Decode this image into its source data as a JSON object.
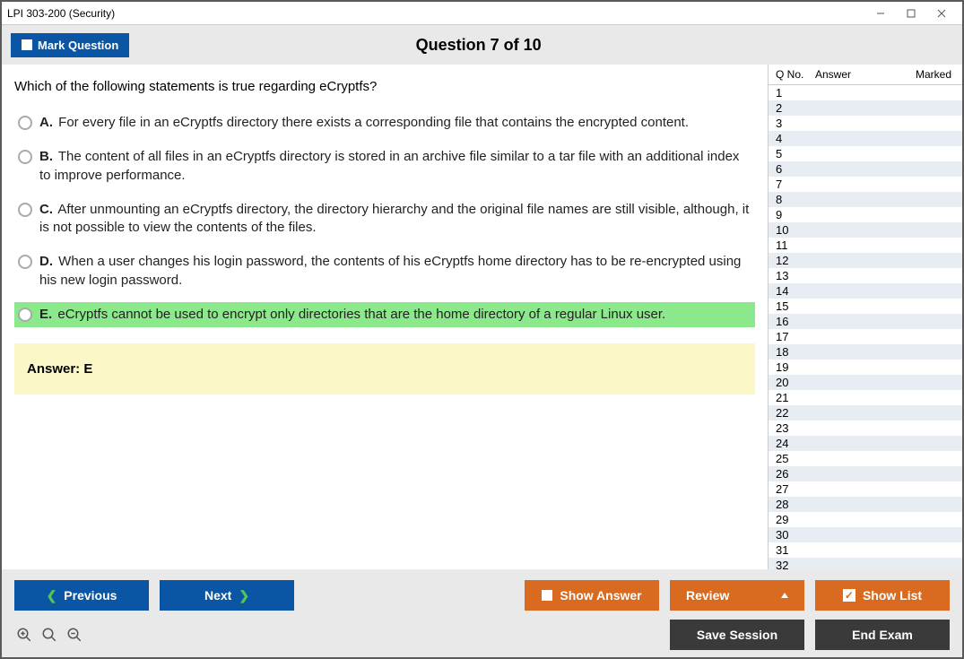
{
  "window": {
    "title": "LPI 303-200 (Security)"
  },
  "header": {
    "mark_label": "Mark Question",
    "question_title": "Question 7 of 10"
  },
  "question": {
    "prompt": "Which of the following statements is true regarding eCryptfs?",
    "options": [
      {
        "letter": "A.",
        "text": "For every file in an eCryptfs directory there exists a corresponding file that contains the encrypted content.",
        "highlight": false
      },
      {
        "letter": "B.",
        "text": "The content of all files in an eCryptfs directory is stored in an archive file similar to a tar file with an additional index to improve performance.",
        "highlight": false
      },
      {
        "letter": "C.",
        "text": "After unmounting an eCryptfs directory, the directory hierarchy and the original file names are still visible, although, it is not possible to view the contents of the files.",
        "highlight": false
      },
      {
        "letter": "D.",
        "text": "When a user changes his login password, the contents of his eCryptfs home directory has to be re-encrypted using his new login password.",
        "highlight": false
      },
      {
        "letter": "E.",
        "text": "eCryptfs cannot be used to encrypt only directories that are the home directory of a regular Linux user.",
        "highlight": true
      }
    ],
    "answer_label": "Answer: E"
  },
  "sidepanel": {
    "headers": {
      "qno": "Q No.",
      "answer": "Answer",
      "marked": "Marked"
    },
    "rows": [
      1,
      2,
      3,
      4,
      5,
      6,
      7,
      8,
      9,
      10,
      11,
      12,
      13,
      14,
      15,
      16,
      17,
      18,
      19,
      20,
      21,
      22,
      23,
      24,
      25,
      26,
      27,
      28,
      29,
      30,
      31,
      32
    ]
  },
  "footer": {
    "previous": "Previous",
    "next": "Next",
    "show_answer": "Show Answer",
    "review": "Review",
    "show_list": "Show List",
    "save_session": "Save Session",
    "end_exam": "End Exam"
  }
}
